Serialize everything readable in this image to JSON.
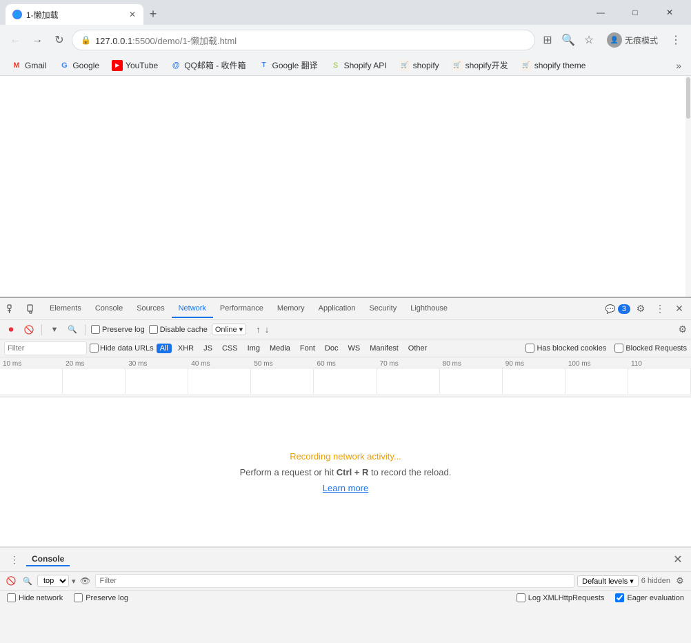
{
  "window": {
    "title": "1-懒加载"
  },
  "titlebar": {
    "tab_label": "1-懒加载",
    "add_tab_label": "+",
    "minimize": "—",
    "maximize": "□",
    "close": "✕"
  },
  "addressbar": {
    "back_label": "←",
    "forward_label": "→",
    "reload_label": "↻",
    "url": "127.0.0.1:5500/demo/1-懒加载.html",
    "url_prefix": "127.0.0.1",
    "url_path": ":5500/demo/1-懒加载.html",
    "translate_label": "⊞",
    "zoom_label": "🔍",
    "bookmark_label": "☆",
    "profile_label": "无痕模式",
    "more_label": "⋮"
  },
  "bookmarks": {
    "items": [
      {
        "label": "Gmail",
        "icon": "G"
      },
      {
        "label": "Google",
        "icon": "G"
      },
      {
        "label": "YouTube",
        "icon": "▶"
      },
      {
        "label": "QQ邮箱 - 收件箱",
        "icon": "Q"
      },
      {
        "label": "Google 翻译",
        "icon": "G"
      },
      {
        "label": "Shopify API",
        "icon": "S"
      },
      {
        "label": "shopify",
        "icon": "S"
      },
      {
        "label": "shopify开发",
        "icon": "S"
      },
      {
        "label": "shopify theme",
        "icon": "S"
      }
    ],
    "more_label": "»"
  },
  "devtools": {
    "tabs": [
      {
        "label": "Elements",
        "active": false
      },
      {
        "label": "Console",
        "active": false
      },
      {
        "label": "Sources",
        "active": false
      },
      {
        "label": "Network",
        "active": true
      },
      {
        "label": "Performance",
        "active": false
      },
      {
        "label": "Memory",
        "active": false
      },
      {
        "label": "Application",
        "active": false
      },
      {
        "label": "Security",
        "active": false
      },
      {
        "label": "Lighthouse",
        "active": false
      }
    ],
    "badge": "3",
    "settings_label": "⚙",
    "more_label": "⋮",
    "close_label": "✕"
  },
  "network_toolbar": {
    "record_label": "⏺",
    "stop_label": "🚫",
    "clear_label": "🚫",
    "filter_label": "▼",
    "search_label": "🔍",
    "preserve_log_label": "Preserve log",
    "disable_cache_label": "Disable cache",
    "online_label": "Online",
    "upload_icon": "↑",
    "download_icon": "↓",
    "settings_label": "⚙"
  },
  "filter_bar": {
    "filter_placeholder": "Filter",
    "hide_data_urls": "Hide data URLs",
    "all_label": "All",
    "xhr_label": "XHR",
    "js_label": "JS",
    "css_label": "CSS",
    "img_label": "Img",
    "media_label": "Media",
    "font_label": "Font",
    "doc_label": "Doc",
    "ws_label": "WS",
    "manifest_label": "Manifest",
    "other_label": "Other",
    "has_blocked_label": "Has blocked cookies",
    "blocked_requests_label": "Blocked Requests"
  },
  "timeline": {
    "labels": [
      "10 ms",
      "20 ms",
      "30 ms",
      "40 ms",
      "50 ms",
      "60 ms",
      "70 ms",
      "80 ms",
      "90 ms",
      "100 ms",
      "110"
    ]
  },
  "empty_state": {
    "recording_text": "Recording network activity...",
    "instruction_text": "Perform a request or hit ",
    "shortcut": "Ctrl + R",
    "instruction_suffix": " to record the reload.",
    "learn_more": "Learn more"
  },
  "console_drawer": {
    "title": "Console",
    "close_label": "✕",
    "clear_label": "🚫",
    "stop_label": "🚫",
    "context_label": "top",
    "filter_placeholder": "Filter",
    "levels_label": "Default levels ▾",
    "hidden_count": "6 hidden",
    "settings_label": "⚙",
    "options": {
      "hide_network": "Hide network",
      "preserve_log": "Preserve log",
      "log_xmlhttp": "Log XMLHttpRequests",
      "eager_eval": "Eager evaluation"
    }
  }
}
